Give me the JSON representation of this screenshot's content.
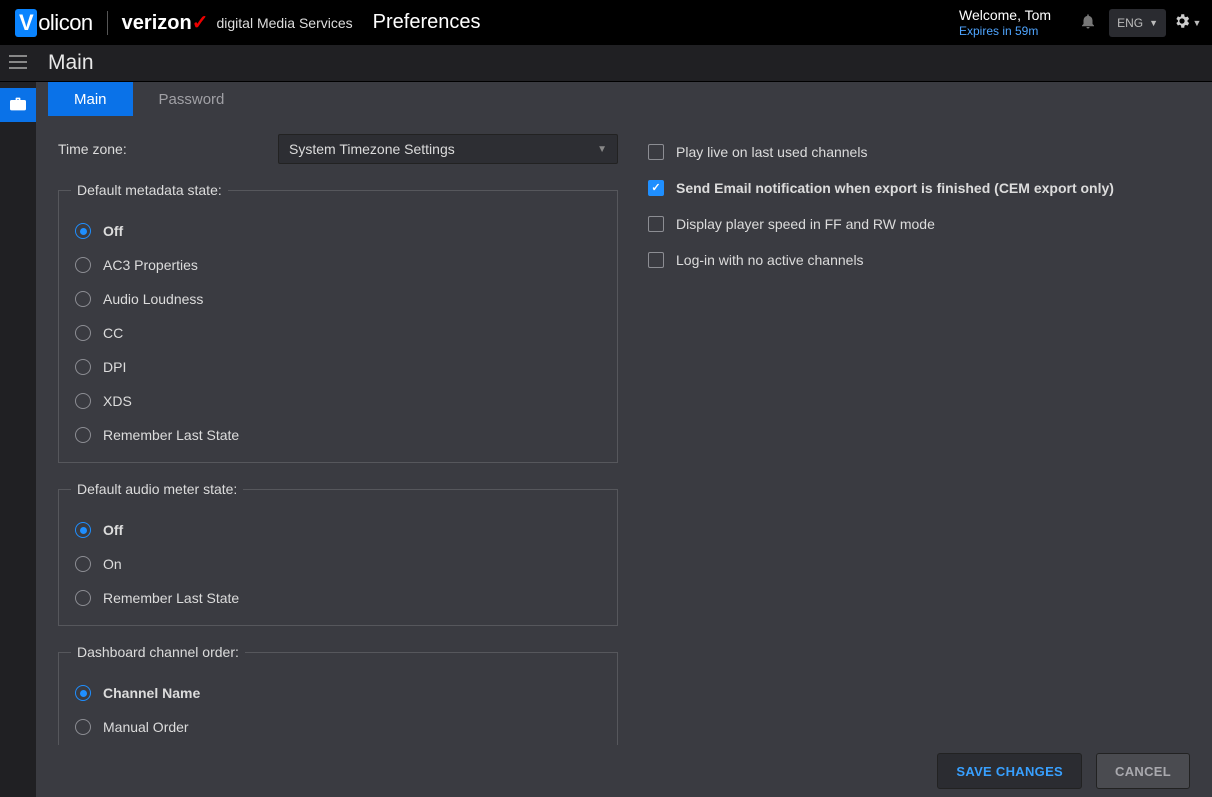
{
  "brand": {
    "volicon_prefix": "V",
    "volicon_rest": "olicon",
    "verizon": "verizon",
    "verizon_check": "✓",
    "dms": "digital Media Services"
  },
  "top": {
    "page_title": "Preferences",
    "welcome": "Welcome, Tom",
    "expires": "Expires in 59m",
    "lang": "ENG"
  },
  "header": {
    "title": "Main"
  },
  "tabs": {
    "main": "Main",
    "password": "Password"
  },
  "form": {
    "timezone_label": "Time zone:",
    "timezone_value": "System Timezone Settings",
    "groups": {
      "metadata": {
        "legend": "Default metadata state:",
        "options": [
          "Off",
          "AC3 Properties",
          "Audio Loudness",
          "CC",
          "DPI",
          "XDS",
          "Remember Last State"
        ],
        "selected": 0
      },
      "audio": {
        "legend": "Default audio meter state:",
        "options": [
          "Off",
          "On",
          "Remember Last State"
        ],
        "selected": 0
      },
      "dashboard": {
        "legend": "Dashboard channel order:",
        "options": [
          "Channel Name",
          "Manual Order"
        ],
        "selected": 0
      }
    },
    "right_checks": [
      {
        "label": "Play live on last used channels",
        "checked": false
      },
      {
        "label": "Send Email notification when export is finished (CEM export only)",
        "checked": true
      },
      {
        "label": "Display player speed in FF and RW mode",
        "checked": false
      },
      {
        "label": "Log-in with no active channels",
        "checked": false
      }
    ]
  },
  "footer": {
    "save": "SAVE CHANGES",
    "cancel": "CANCEL"
  }
}
